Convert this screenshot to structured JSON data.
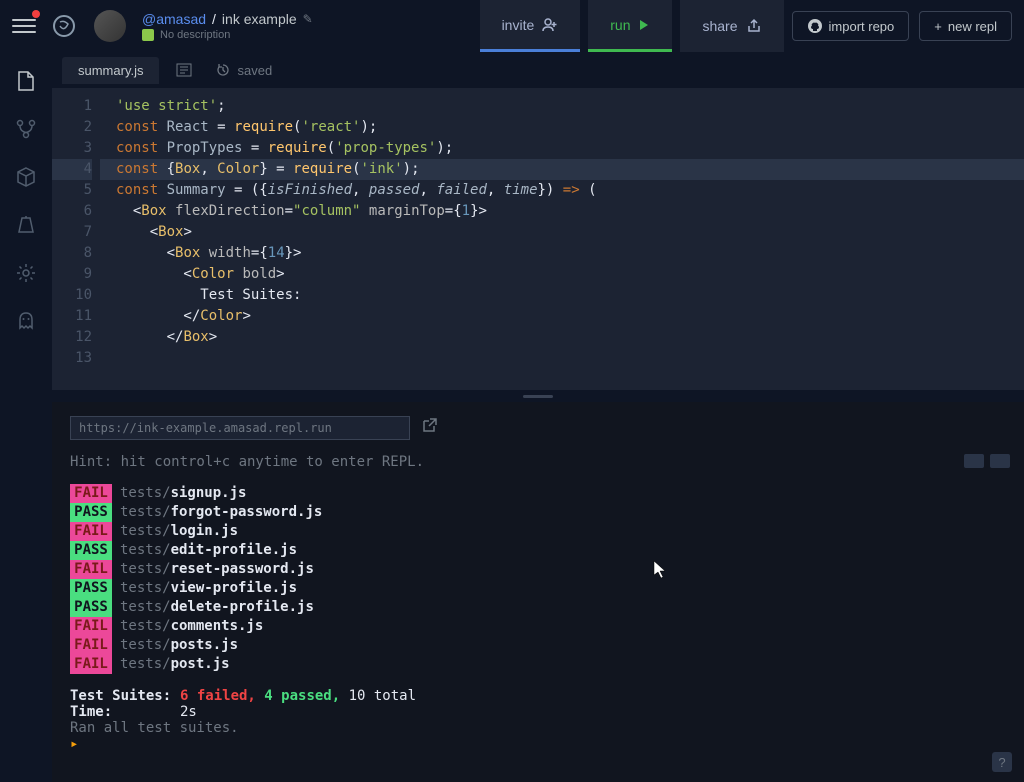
{
  "header": {
    "owner": "@amasad",
    "repl_name": "ink example",
    "description": "No description",
    "invite_label": "invite",
    "run_label": "run",
    "share_label": "share",
    "import_label": "import repo",
    "new_repl_label": "new repl"
  },
  "tabs": {
    "active": "summary.js",
    "saved_label": "saved"
  },
  "editor": {
    "lines": [
      {
        "n": 1,
        "hl": false,
        "tokens": [
          {
            "t": "'use strict'",
            "c": "tok-str"
          },
          {
            "t": ";",
            "c": ""
          }
        ]
      },
      {
        "n": 2,
        "hl": false,
        "tokens": [
          {
            "t": "const ",
            "c": "tok-kw"
          },
          {
            "t": "React",
            "c": "tok-var"
          },
          {
            "t": " = ",
            "c": ""
          },
          {
            "t": "require",
            "c": "tok-type"
          },
          {
            "t": "(",
            "c": ""
          },
          {
            "t": "'react'",
            "c": "tok-str"
          },
          {
            "t": ");",
            "c": ""
          }
        ]
      },
      {
        "n": 3,
        "hl": false,
        "tokens": [
          {
            "t": "const ",
            "c": "tok-kw"
          },
          {
            "t": "PropTypes",
            "c": "tok-var"
          },
          {
            "t": " = ",
            "c": ""
          },
          {
            "t": "require",
            "c": "tok-type"
          },
          {
            "t": "(",
            "c": ""
          },
          {
            "t": "'prop-types'",
            "c": "tok-str"
          },
          {
            "t": ");",
            "c": ""
          }
        ]
      },
      {
        "n": 4,
        "hl": true,
        "tokens": [
          {
            "t": "const ",
            "c": "tok-kw"
          },
          {
            "t": "{",
            "c": ""
          },
          {
            "t": "Box",
            "c": "tok-comp"
          },
          {
            "t": ", ",
            "c": ""
          },
          {
            "t": "Color",
            "c": "tok-comp"
          },
          {
            "t": "} = ",
            "c": ""
          },
          {
            "t": "require",
            "c": "tok-type"
          },
          {
            "t": "(",
            "c": ""
          },
          {
            "t": "'ink'",
            "c": "tok-str"
          },
          {
            "t": ");",
            "c": ""
          }
        ]
      },
      {
        "n": 5,
        "hl": false,
        "tokens": []
      },
      {
        "n": 6,
        "hl": false,
        "tokens": [
          {
            "t": "const ",
            "c": "tok-kw"
          },
          {
            "t": "Summary",
            "c": "tok-var"
          },
          {
            "t": " = ({",
            "c": ""
          },
          {
            "t": "isFinished",
            "c": "tok-param"
          },
          {
            "t": ", ",
            "c": ""
          },
          {
            "t": "passed",
            "c": "tok-param"
          },
          {
            "t": ", ",
            "c": ""
          },
          {
            "t": "failed",
            "c": "tok-param"
          },
          {
            "t": ", ",
            "c": ""
          },
          {
            "t": "time",
            "c": "tok-param"
          },
          {
            "t": "}) ",
            "c": ""
          },
          {
            "t": "=> ",
            "c": "tok-kw"
          },
          {
            "t": "(",
            "c": ""
          }
        ]
      },
      {
        "n": 7,
        "hl": false,
        "tokens": [
          {
            "t": "  <",
            "c": ""
          },
          {
            "t": "Box",
            "c": "tok-comp"
          },
          {
            "t": " ",
            "c": ""
          },
          {
            "t": "flexDirection",
            "c": "tok-attr"
          },
          {
            "t": "=",
            "c": ""
          },
          {
            "t": "\"column\"",
            "c": "tok-str"
          },
          {
            "t": " ",
            "c": ""
          },
          {
            "t": "marginTop",
            "c": "tok-attr"
          },
          {
            "t": "={",
            "c": ""
          },
          {
            "t": "1",
            "c": "tok-num"
          },
          {
            "t": "}>",
            "c": ""
          }
        ]
      },
      {
        "n": 8,
        "hl": false,
        "tokens": [
          {
            "t": "    <",
            "c": ""
          },
          {
            "t": "Box",
            "c": "tok-comp"
          },
          {
            "t": ">",
            "c": ""
          }
        ]
      },
      {
        "n": 9,
        "hl": false,
        "tokens": [
          {
            "t": "      <",
            "c": ""
          },
          {
            "t": "Box",
            "c": "tok-comp"
          },
          {
            "t": " ",
            "c": ""
          },
          {
            "t": "width",
            "c": "tok-attr"
          },
          {
            "t": "={",
            "c": ""
          },
          {
            "t": "14",
            "c": "tok-num"
          },
          {
            "t": "}>",
            "c": ""
          }
        ]
      },
      {
        "n": 10,
        "hl": false,
        "tokens": [
          {
            "t": "        <",
            "c": ""
          },
          {
            "t": "Color",
            "c": "tok-comp"
          },
          {
            "t": " ",
            "c": ""
          },
          {
            "t": "bold",
            "c": "tok-attr"
          },
          {
            "t": ">",
            "c": ""
          }
        ]
      },
      {
        "n": 11,
        "hl": false,
        "tokens": [
          {
            "t": "          Test Suites:",
            "c": ""
          }
        ]
      },
      {
        "n": 12,
        "hl": false,
        "tokens": [
          {
            "t": "        </",
            "c": ""
          },
          {
            "t": "Color",
            "c": "tok-comp"
          },
          {
            "t": ">",
            "c": ""
          }
        ]
      },
      {
        "n": 13,
        "hl": false,
        "tokens": [
          {
            "t": "      </",
            "c": ""
          },
          {
            "t": "Box",
            "c": "tok-comp"
          },
          {
            "t": ">",
            "c": ""
          }
        ]
      }
    ]
  },
  "console": {
    "url_value": "https://ink-example.amasad.repl.run",
    "hint": "Hint: hit control+c anytime to enter REPL.",
    "tests": [
      {
        "status": "FAIL",
        "dir": "tests/",
        "file": "signup.js"
      },
      {
        "status": "PASS",
        "dir": "tests/",
        "file": "forgot-password.js"
      },
      {
        "status": "FAIL",
        "dir": "tests/",
        "file": "login.js"
      },
      {
        "status": "PASS",
        "dir": "tests/",
        "file": "edit-profile.js"
      },
      {
        "status": "FAIL",
        "dir": "tests/",
        "file": "reset-password.js"
      },
      {
        "status": "PASS",
        "dir": "tests/",
        "file": "view-profile.js"
      },
      {
        "status": "PASS",
        "dir": "tests/",
        "file": "delete-profile.js"
      },
      {
        "status": "FAIL",
        "dir": "tests/",
        "file": "comments.js"
      },
      {
        "status": "FAIL",
        "dir": "tests/",
        "file": "posts.js"
      },
      {
        "status": "FAIL",
        "dir": "tests/",
        "file": "post.js"
      }
    ],
    "summary": {
      "suites_label": "Test Suites:",
      "failed_count": "6 failed,",
      "passed_count": "4 passed,",
      "total": "10 total",
      "time_label": "Time:",
      "time_value": "2s",
      "ran_msg": "Ran all test suites.",
      "prompt": "▸"
    }
  }
}
